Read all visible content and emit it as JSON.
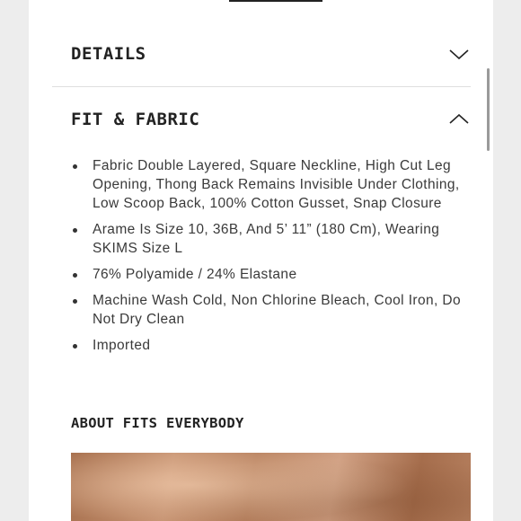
{
  "sections": {
    "details": {
      "title": "DETAILS",
      "expanded": false,
      "icon": "chevron-down-icon"
    },
    "fit_fabric": {
      "title": "FIT & FABRIC",
      "expanded": true,
      "icon": "chevron-up-icon",
      "bullets": [
        "Fabric Double Layered, Square Neckline, High Cut Leg Opening, Thong Back Remains Invisible Under Clothing, Low Scoop Back, 100% Cotton Gusset, Snap Closure",
        "Arame Is Size 10, 36B, And 5’ 11” (180 Cm), Wearing SKIMS Size L",
        "76% Polyamide / 24% Elastane",
        "Machine Wash Cold, Non Chlorine Bleach, Cool Iron, Do Not Dry Clean",
        "Imported"
      ]
    },
    "about": {
      "title": "ABOUT FITS EVERYBODY"
    }
  },
  "colors": {
    "text": "#222222",
    "body_text": "#3a3a3a",
    "divider": "#dedede",
    "background": "#ededed",
    "image_tone": "#c08b69"
  }
}
